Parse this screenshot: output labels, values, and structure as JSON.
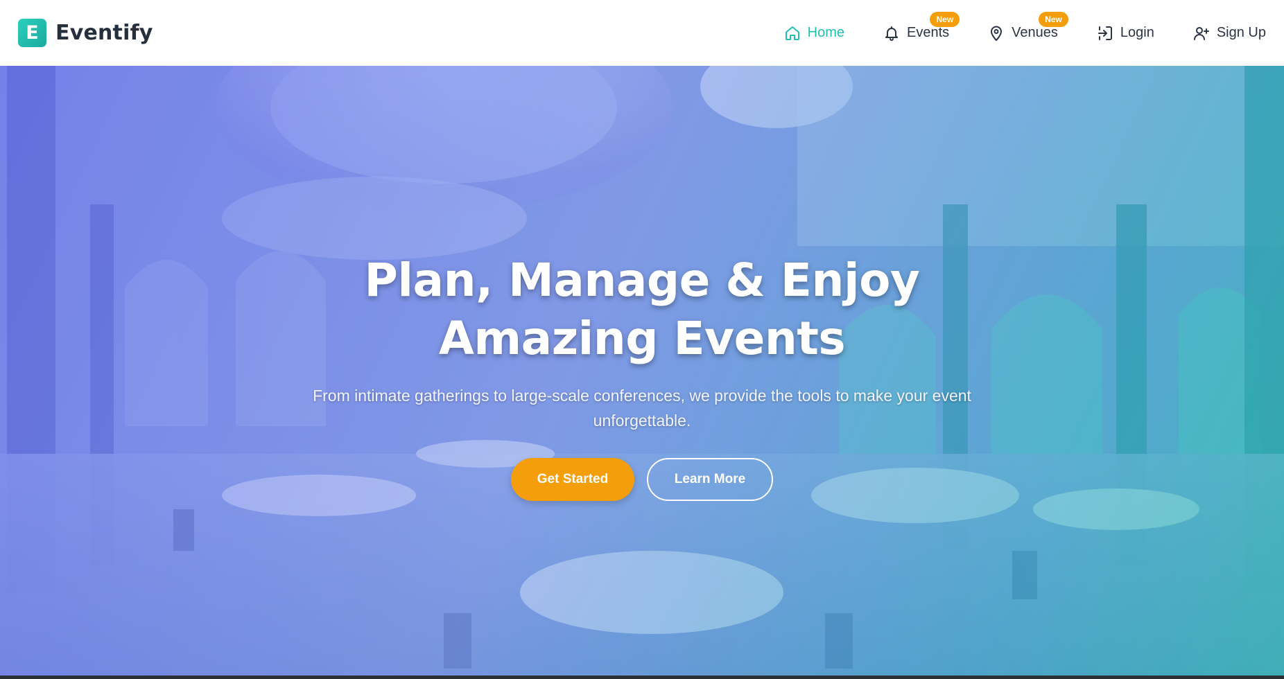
{
  "brand": {
    "logo_letter": "E",
    "name": "Eventify"
  },
  "nav": {
    "items": [
      {
        "label": "Home",
        "icon": "home-icon",
        "active": true,
        "badge": ""
      },
      {
        "label": "Events",
        "icon": "bell-icon",
        "active": false,
        "badge": "New"
      },
      {
        "label": "Venues",
        "icon": "map-pin-icon",
        "active": false,
        "badge": "New"
      },
      {
        "label": "Login",
        "icon": "login-icon",
        "active": false,
        "badge": ""
      },
      {
        "label": "Sign Up",
        "icon": "user-plus-icon",
        "active": false,
        "badge": ""
      }
    ]
  },
  "hero": {
    "title_line1": "Plan, Manage & Enjoy",
    "title_line2": "Amazing Events",
    "subtitle": "From intimate gatherings to large-scale conferences, we provide the tools to make your event unforgettable.",
    "primary_cta": "Get Started",
    "secondary_cta": "Learn More",
    "background_image": "ballroom-banquet-hall"
  },
  "colors": {
    "accent": "#20bfb0",
    "badge": "#f59e0b",
    "primary_button": "#f59e0b",
    "text_dark": "#26303d"
  }
}
